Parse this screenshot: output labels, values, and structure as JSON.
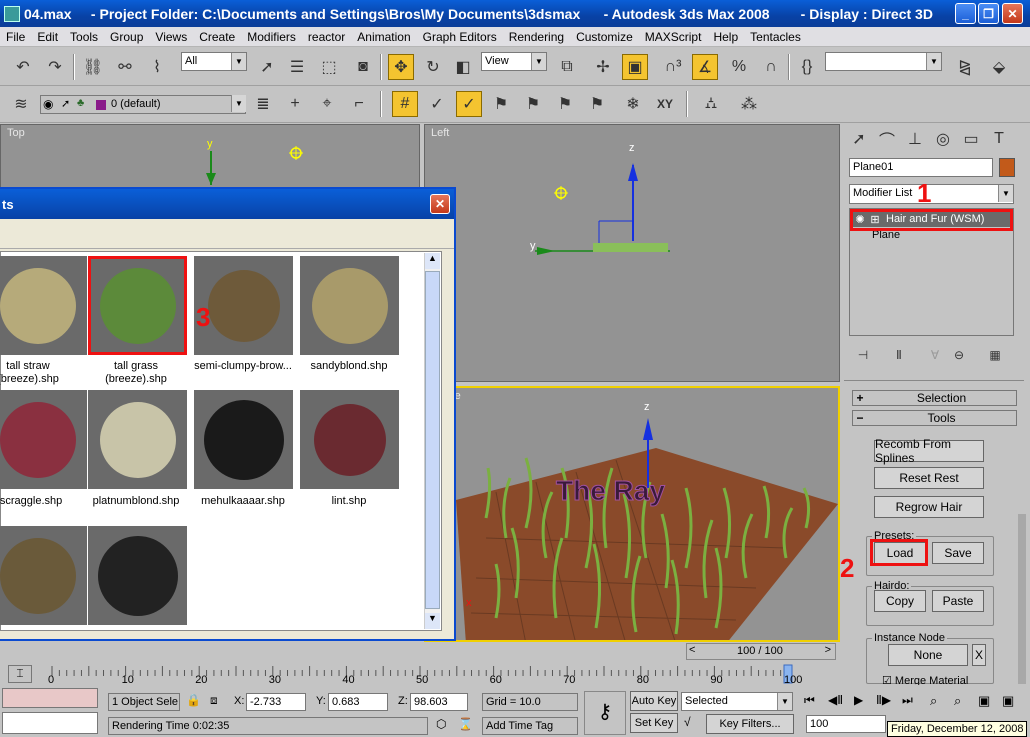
{
  "window": {
    "title": "04.max     - Project Folder: C:\\Documents and Settings\\Bros\\My Documents\\3dsmax      - Autodesk 3ds Max 2008        - Display : Direct 3D",
    "buttons": [
      "_",
      "❐",
      "✕"
    ]
  },
  "menu": [
    "File",
    "Edit",
    "Tools",
    "Group",
    "Views",
    "Create",
    "Modifiers",
    "reactor",
    "Animation",
    "Graph Editors",
    "Rendering",
    "Customize",
    "MAXScript",
    "Help",
    "Tentacles"
  ],
  "toolbar": {
    "selection_filter": "All",
    "ref_coord": "View",
    "named_selection": ""
  },
  "layer_toolbar": {
    "current_layer": "0 (default)"
  },
  "viewports": {
    "top": "Top",
    "left": "Left",
    "perspective": "ective",
    "axis_z": "z",
    "axis_y": "y",
    "axis_x": "x",
    "watermark": "The Ray"
  },
  "time_slider": {
    "label": "100 / 100",
    "ticks": [
      "0",
      "10",
      "20",
      "30",
      "40",
      "50",
      "60",
      "70",
      "80",
      "90",
      "100"
    ]
  },
  "command_panel": {
    "object_name": "Plane01",
    "modifier_list_label": "Modifier List",
    "stack": [
      "Hair and Fur (WSM)",
      "Plane"
    ],
    "rollouts": {
      "selection": {
        "sign": "+",
        "label": "Selection"
      },
      "tools": {
        "sign": "−",
        "label": "Tools"
      }
    },
    "buttons": {
      "recomb": "Recomb From Splines",
      "reset_rest": "Reset Rest",
      "regrow": "Regrow Hair",
      "load": "Load",
      "save": "Save",
      "copy": "Copy",
      "paste": "Paste",
      "none": "None",
      "x": "X"
    },
    "groups": {
      "presets": "Presets:",
      "hairdo": "Hairdo:",
      "instance_node": "Instance Node",
      "merge_material": "Merge Material"
    }
  },
  "annotations": [
    "1",
    "2",
    "3"
  ],
  "dialog": {
    "title": "ts",
    "close": "✕",
    "presets": [
      {
        "label": "tall straw\n(breeze).shp",
        "color": "#b6aa7a"
      },
      {
        "label": "tall grass\n(breeze).shp",
        "color": "#5c8a3a"
      },
      {
        "label": "semi-clumpy-brow...",
        "color": "#6e5a3a"
      },
      {
        "label": "sandyblond.shp",
        "color": "#a89a6a"
      },
      {
        "label": "dscraggle.shp",
        "color": "#8a3040"
      },
      {
        "label": "platnumblond.shp",
        "color": "#c8c4a8"
      },
      {
        "label": "mehulkaaaar.shp",
        "color": "#1a1a1a"
      },
      {
        "label": "lint.shp",
        "color": "#6a2a30"
      },
      {
        "label": "",
        "color": "#6a5a3a"
      },
      {
        "label": "",
        "color": "#222222"
      }
    ]
  },
  "status": {
    "selected": "1 Object Sele",
    "x_label": "X:",
    "x_value": "-2.733",
    "y_label": "Y:",
    "y_value": "0.683",
    "z_label": "Z:",
    "z_value": "98.603",
    "grid": "Grid = 10.0",
    "auto_key": "Auto Key",
    "set_key": "Set Key",
    "key_mode": "Selected",
    "key_filters": "Key Filters...",
    "frame": "100",
    "rendering_time": "Rendering Time  0:02:35",
    "add_time_tag": "Add Time Tag",
    "tooltip_date": "Friday, December 12, 2008"
  }
}
